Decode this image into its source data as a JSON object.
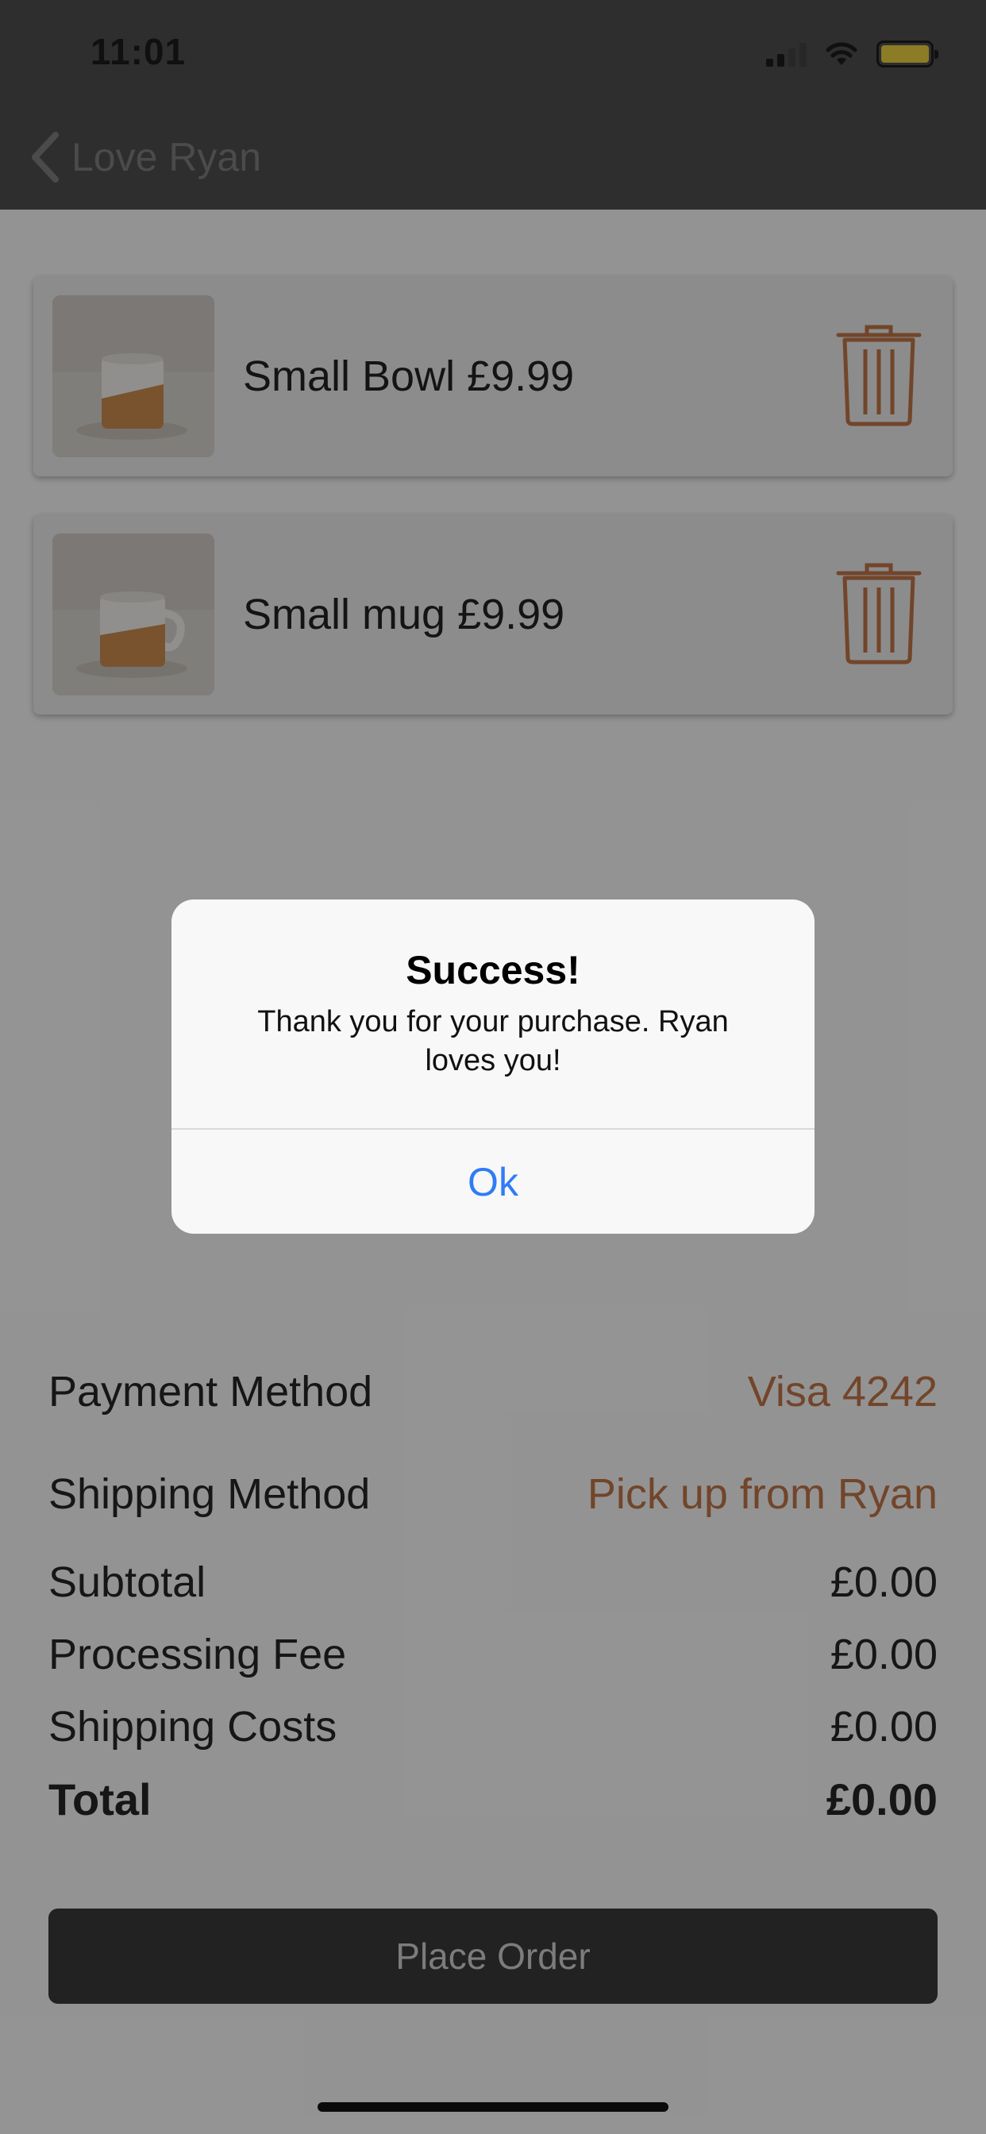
{
  "status_bar": {
    "time": "11:01"
  },
  "header": {
    "back_label": "Love Ryan"
  },
  "cart": {
    "items": [
      {
        "name": "Small Bowl",
        "price": "£9.99",
        "label": "Small Bowl  £9.99"
      },
      {
        "name": "Small mug",
        "price": "£9.99",
        "label": "Small mug £9.99"
      }
    ]
  },
  "summary": {
    "payment_method_label": "Payment Method",
    "payment_method_value": "Visa 4242",
    "shipping_method_label": "Shipping Method",
    "shipping_method_value": "Pick up from Ryan",
    "subtotal_label": "Subtotal",
    "subtotal_value": "£0.00",
    "processing_fee_label": "Processing Fee",
    "processing_fee_value": "£0.00",
    "shipping_costs_label": "Shipping Costs",
    "shipping_costs_value": "£0.00",
    "total_label": "Total",
    "total_value": "£0.00"
  },
  "place_order_label": "Place Order",
  "alert": {
    "title": "Success!",
    "message": "Thank you for your purchase. Ryan loves you!",
    "ok_label": "Ok"
  },
  "colors": {
    "accent": "#bf7446",
    "alert_button": "#2f7cf6",
    "battery": "#e8cf3f"
  },
  "icons": {
    "back": "chevron-left-icon",
    "delete": "trash-icon",
    "wifi": "wifi-icon",
    "signal": "cellular-signal-icon",
    "battery": "battery-icon"
  }
}
